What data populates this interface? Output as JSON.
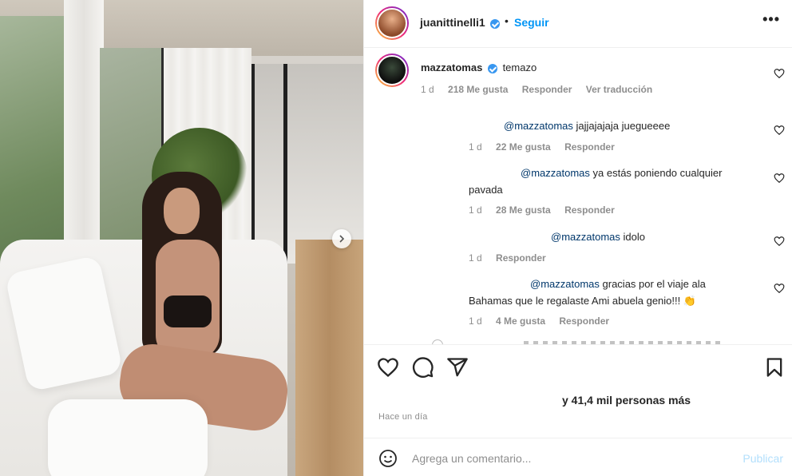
{
  "post": {
    "author": "juanittinelli1",
    "separator": "•",
    "follow_label": "Seguir",
    "more_label": "•••",
    "likes_text": "y 41,4 mil personas más",
    "time_text": "Hace un día"
  },
  "comments": [
    {
      "user": "mazzatomas",
      "text": "temazo",
      "time": "1 d",
      "likes": "218 Me gusta",
      "reply": "Responder",
      "translate": "Ver traducción"
    }
  ],
  "replies": [
    {
      "mention": "@mazzatomas",
      "text": "jajjajajaja jueguееее",
      "time": "1 d",
      "likes": "22 Me gusta",
      "reply": "Responder"
    },
    {
      "mention": "@mazzatomas",
      "text": "ya estás poniendo cualquier",
      "text2": "pavada",
      "time": "1 d",
      "likes": "28 Me gusta",
      "reply": "Responder"
    },
    {
      "mention": "@mazzatomas",
      "text": "idolo",
      "time": "1 d",
      "reply": "Responder"
    },
    {
      "mention": "@mazzatomas",
      "text": "gracias por el viaje ala",
      "text2": "Bahamas que le regalaste Ami abuela genio!!! 👏",
      "time": "1 d",
      "likes": "4 Me gusta",
      "reply": "Responder"
    }
  ],
  "add_comment": {
    "placeholder": "Agrega un comentario...",
    "publish_label": "Publicar"
  },
  "colors": {
    "link": "#0095f6",
    "mention": "#00376b",
    "verified": "#3897f0",
    "muted": "#8e8e8e"
  },
  "icons": [
    "carousel-next-icon",
    "verified-icon",
    "more-icon",
    "heart-icon",
    "comment-icon",
    "share-icon",
    "bookmark-icon",
    "emoji-icon"
  ]
}
